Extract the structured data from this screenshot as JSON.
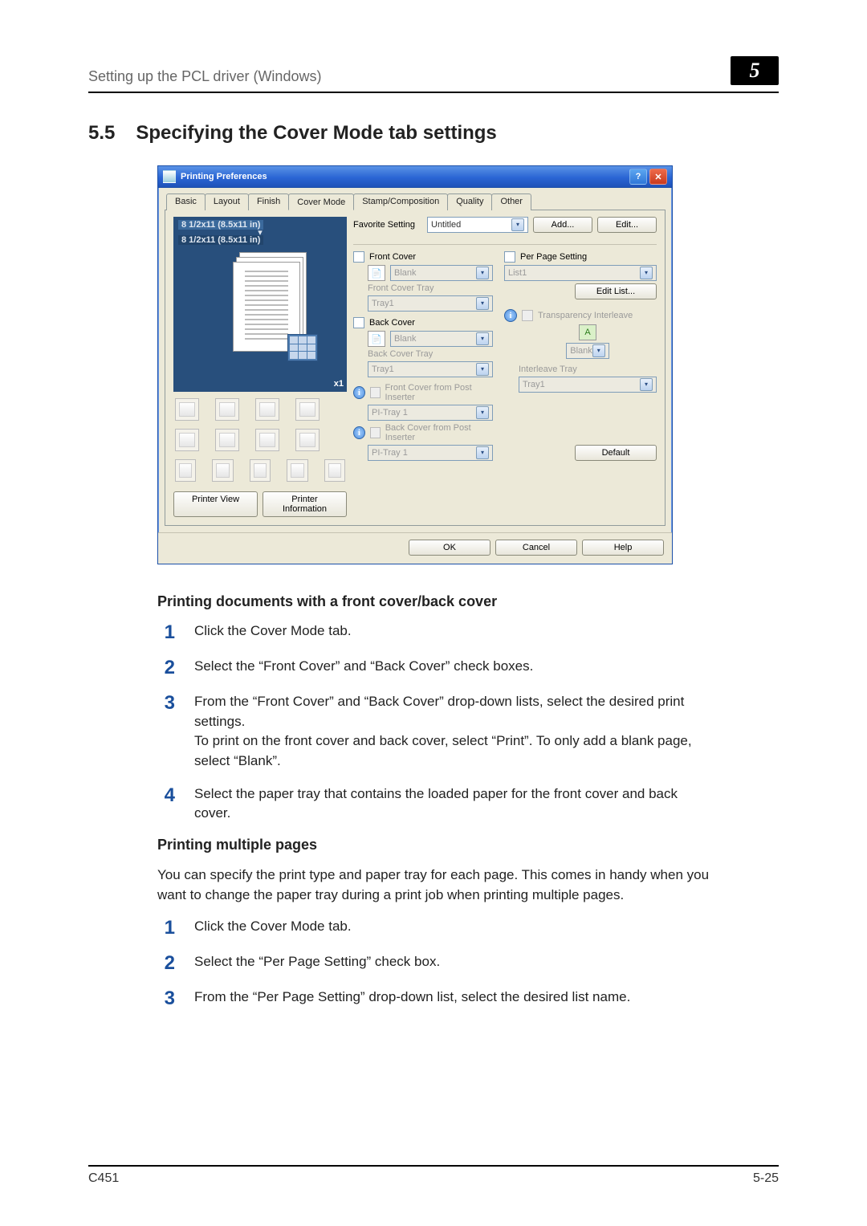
{
  "header": {
    "running_title": "Setting up the PCL driver (Windows)",
    "chapter_num": "5"
  },
  "section": {
    "num": "5.5",
    "title": "Specifying the Cover Mode tab settings"
  },
  "dialog": {
    "title": "Printing Preferences",
    "help_btn": "?",
    "close_btn": "✕",
    "tabs": {
      "basic": "Basic",
      "layout": "Layout",
      "finish": "Finish",
      "cover_mode": "Cover Mode",
      "stamp": "Stamp/Composition",
      "quality": "Quality",
      "other": "Other"
    },
    "favorite": {
      "label": "Favorite Setting",
      "value": "Untitled",
      "add_btn": "Add...",
      "edit_btn": "Edit..."
    },
    "preview": {
      "line1": "8 1/2x11 (8.5x11 in)",
      "line2": "8 1/2x11 (8.5x11 in)",
      "mult": "x1"
    },
    "printer_view_btn": "Printer View",
    "printer_info_btn": "Printer Information",
    "front_cover": {
      "label": "Front Cover",
      "mode": "Blank",
      "tray_label": "Front Cover Tray",
      "tray_value": "Tray1"
    },
    "back_cover": {
      "label": "Back Cover",
      "mode": "Blank",
      "tray_label": "Back Cover Tray",
      "tray_value": "Tray1"
    },
    "pi_front": {
      "label": "Front Cover from Post Inserter",
      "value": "PI-Tray 1"
    },
    "pi_back": {
      "label": "Back Cover from Post Inserter",
      "value": "PI-Tray 1"
    },
    "per_page": {
      "label": "Per Page Setting",
      "list_value": "List1",
      "edit_btn": "Edit List..."
    },
    "transparency": {
      "label": "Transparency Interleave",
      "mode": "Blank",
      "tray_label": "Interleave Tray",
      "tray_value": "Tray1"
    },
    "default_btn": "Default",
    "ok_btn": "OK",
    "cancel_btn": "Cancel",
    "help_btn2": "Help"
  },
  "body1": {
    "heading": "Printing documents with a front cover/back cover",
    "step1": "Click the Cover Mode tab.",
    "step2": "Select the “Front Cover” and “Back Cover” check boxes.",
    "step3a": "From the “Front Cover” and “Back Cover” drop-down lists, select the desired print settings.",
    "step3b": "To print on the front cover and back cover, select “Print”. To only add a blank page, select “Blank”.",
    "step4": "Select the paper tray that contains the loaded paper for the front cover and back cover."
  },
  "body2": {
    "heading": "Printing multiple pages",
    "intro": "You can specify the print type and paper tray for each page. This comes in handy when you want to change the paper tray during a print job when printing multiple pages.",
    "step1": "Click the Cover Mode tab.",
    "step2": "Select the “Per Page Setting” check box.",
    "step3": "From the “Per Page Setting” drop-down list, select the desired list name."
  },
  "footer": {
    "model": "C451",
    "page": "5-25"
  }
}
